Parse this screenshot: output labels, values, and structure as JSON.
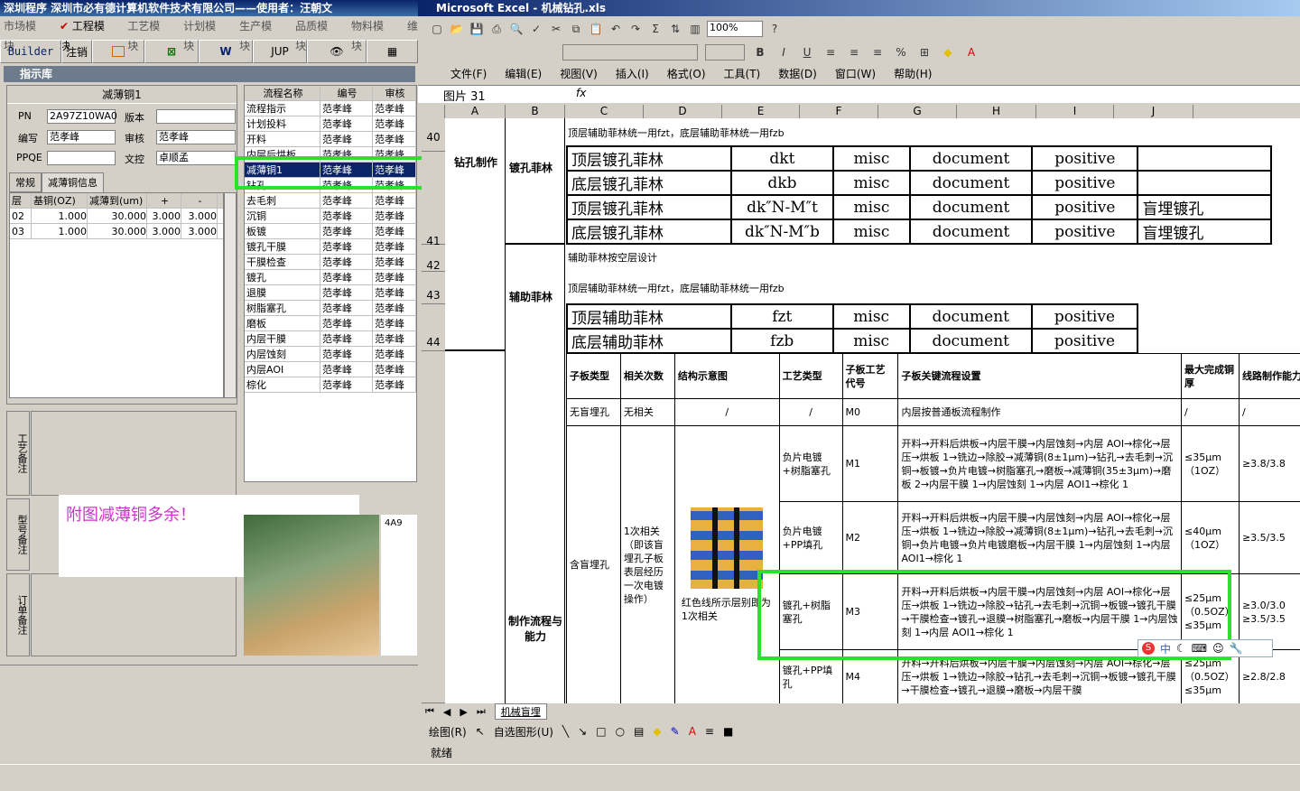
{
  "left": {
    "title": "深圳程序  深圳市必有德计算机软件技术有限公司——使用者：汪朝文",
    "menu": [
      "市场模块",
      "工程模块",
      "工艺模块",
      "计划模块",
      "生产模块",
      "品质模块",
      "物料模块",
      "维"
    ],
    "tools": [
      "Builder",
      "注销",
      "",
      "",
      "W",
      "JUP",
      "",
      ""
    ],
    "panel_title": "指示库",
    "card_title": "减薄铜1",
    "pn_label": "PN",
    "pn_value": "2A97Z10WA0",
    "version_label": "版本",
    "version_value": "",
    "author_label": "编写",
    "author_value": "范孝峰",
    "review_label": "审核",
    "review_value": "范孝峰",
    "ppqe_label": "PPQE",
    "ppqe_value": "",
    "docctrl_label": "文控",
    "docctrl_value": "卓顺孟",
    "tabs": [
      "常规",
      "减薄铜信息"
    ],
    "layer_headers": [
      "层",
      "基铜(OZ)",
      "减薄到(um)",
      "+",
      "-"
    ],
    "layer_rows": [
      [
        "02",
        "1.000",
        "30.000",
        "3.000",
        "3.000"
      ],
      [
        "03",
        "1.000",
        "30.000",
        "3.000",
        "3.000"
      ]
    ],
    "flow_headers": [
      "流程名称",
      "编号",
      "审核"
    ],
    "flow_rows": [
      [
        "流程指示",
        "范孝峰",
        "范孝峰"
      ],
      [
        "计划投料",
        "范孝峰",
        "范孝峰"
      ],
      [
        "开料",
        "范孝峰",
        "范孝峰"
      ],
      [
        "内层后烘板",
        "范孝峰",
        "范孝峰"
      ],
      [
        "减薄铜1",
        "范孝峰",
        "范孝峰"
      ],
      [
        "钻孔",
        "范孝峰",
        "范孝峰"
      ],
      [
        "去毛刺",
        "范孝峰",
        "范孝峰"
      ],
      [
        "沉铜",
        "范孝峰",
        "范孝峰"
      ],
      [
        "板镀",
        "范孝峰",
        "范孝峰"
      ],
      [
        "镀孔干膜",
        "范孝峰",
        "范孝峰"
      ],
      [
        "干膜检查",
        "范孝峰",
        "范孝峰"
      ],
      [
        "镀孔",
        "范孝峰",
        "范孝峰"
      ],
      [
        "退膜",
        "范孝峰",
        "范孝峰"
      ],
      [
        "树脂塞孔",
        "范孝峰",
        "范孝峰"
      ],
      [
        "磨板",
        "范孝峰",
        "范孝峰"
      ],
      [
        "内层干膜",
        "范孝峰",
        "范孝峰"
      ],
      [
        "内层蚀刻",
        "范孝峰",
        "范孝峰"
      ],
      [
        "内层AOI",
        "范孝峰",
        "范孝峰"
      ],
      [
        "棕化",
        "范孝峰",
        "范孝峰"
      ]
    ],
    "side_labels": [
      "工艺备注",
      "型号备注",
      "订单备注"
    ],
    "note": "附图减薄铜多余！",
    "tree_item": "4A9"
  },
  "excel": {
    "title": "Microsoft Excel - 机械钻孔.xls",
    "zoom": "100%",
    "menu": [
      "文件(F)",
      "编辑(E)",
      "视图(V)",
      "插入(I)",
      "格式(O)",
      "工具(T)",
      "数据(D)",
      "窗口(W)",
      "帮助(H)"
    ],
    "namebox": "图片 31",
    "fx": "fx",
    "columns": [
      "A",
      "B",
      "C",
      "D",
      "E",
      "F",
      "G",
      "H",
      "I",
      "J"
    ],
    "rows": {
      "r40": "40",
      "r41": "41",
      "r42": "42",
      "r43": "43",
      "r44": "44"
    },
    "drill_label": "钻孔制作",
    "plated_label": "镀孔菲林",
    "aux_label": "辅助菲林",
    "flow_label": "制作流程与能力",
    "note1": "顶层辅助菲林统一用fzt，底层辅助菲林统一用fzb",
    "plated_rows": [
      [
        "顶层镀孔菲林",
        "dkt",
        "misc",
        "document",
        "positive",
        ""
      ],
      [
        "底层镀孔菲林",
        "dkb",
        "misc",
        "document",
        "positive",
        ""
      ],
      [
        "顶层镀孔菲林",
        "dk″N-M″t",
        "misc",
        "document",
        "positive",
        "盲埋镀孔"
      ],
      [
        "底层镀孔菲林",
        "dk″N-M″b",
        "misc",
        "document",
        "positive",
        "盲埋镀孔"
      ]
    ],
    "aux_note": "辅助菲林按空层设计",
    "aux_note2": "顶层辅助菲林统一用fzt，底层辅助菲林统一用fzb",
    "aux_rows": [
      [
        "顶层辅助菲林",
        "fzt",
        "misc",
        "document",
        "positive"
      ],
      [
        "底层辅助菲林",
        "fzb",
        "misc",
        "document",
        "positive"
      ]
    ],
    "proc_headers": [
      "子板类型",
      "相关次数",
      "结构示意图",
      "工艺类型",
      "子板工艺代号",
      "子板关键流程设置",
      "最大完成铜厚",
      "线路制作能力"
    ],
    "proc_row0": [
      "无盲埋孔",
      "无相关",
      "/",
      "/",
      "M0",
      "内层按普通板流程制作",
      "/",
      "/"
    ],
    "proc_type": "含盲埋孔",
    "proc_count": "1次相关（即该盲埋孔子板表层经历一次电镀操作）",
    "diagram_caption": "红色线所示层别即为1次相关",
    "proc_rows": [
      [
        "负片电镀+树脂塞孔",
        "M1",
        "开料→开料后烘板→内层干膜→内层蚀刻→内层 AOI→棕化→层压→烘板 1→铣边→除胶→减薄铜(8±1μm)→钻孔→去毛刺→沉铜→板镀→负片电镀→树脂塞孔→磨板→减薄铜(35±3μm)→磨板 2→内层干膜 1→内层蚀刻 1→内层 AOI1→棕化 1",
        "≤35μm（1OZ）",
        "≥3.8/3.8"
      ],
      [
        "负片电镀+PP填孔",
        "M2",
        "开料→开料后烘板→内层干膜→内层蚀刻→内层 AOI→棕化→层压→烘板 1→铣边→除胶→减薄铜(8±1μm)→钻孔→去毛刺→沉铜→负片电镀→负片电镀磨板→内层干膜 1→内层蚀刻 1→内层 AOI1→棕化 1",
        "≤40μm（1OZ）",
        "≥3.5/3.5"
      ],
      [
        "镀孔+树脂塞孔",
        "M3",
        "开料→开料后烘板→内层干膜→内层蚀刻→内层 AOI→棕化→层压→烘板 1→铣边→除胶→钻孔→去毛刺→沉铜→板镀→镀孔干膜→干膜检查→镀孔→退膜→树脂塞孔→磨板→内层干膜 1→内层蚀刻 1→内层 AOI1→棕化 1",
        "≤25μm（0.5OZ）",
        "≥3.0/3.0"
      ],
      [
        "镀孔+PP填孔",
        "M4",
        "开料→开料后烘板→内层干膜→内层蚀刻→内层 AOI→棕化→层压→烘板 1→铣边→除胶→钻孔→去毛刺→沉铜→板镀→镀孔干膜→干膜检查→镀孔→退膜→磨板→内层干膜",
        "≤25μm（0.5OZ）",
        "≥2.8/2.8"
      ]
    ],
    "m3_extra": "≤35μm",
    "m3_extra2": "≥3.5/3.5",
    "m4_extra": "≤35μm",
    "sheet_tab": "机械盲埋",
    "draw_label": "绘图(R)",
    "autoshape": "自选图形(U)",
    "status": "就绪",
    "ime": "中"
  },
  "colors": {
    "highlight": "#2ee02e",
    "note": "#cc33cc"
  }
}
